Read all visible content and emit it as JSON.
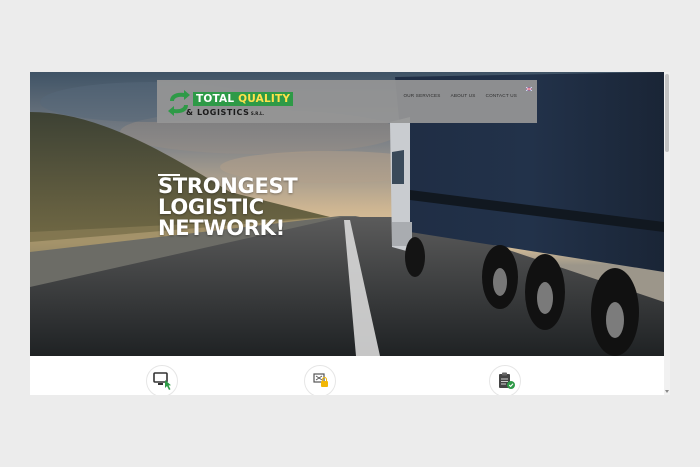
{
  "navbar": {
    "logo": {
      "line1_a": "TOTAL ",
      "line1_b": "QUALITY",
      "line2": "& LOGISTICS",
      "line2_suffix": " S.R.L."
    },
    "menu": [
      "OUR SERVICES",
      "ABOUT US",
      "CONTACT US"
    ],
    "language_icon": "uk-flag-icon"
  },
  "hero": {
    "headline": [
      "STRONGEST",
      "LOGISTIC",
      "NETWORK!"
    ]
  },
  "services": [
    {
      "icon": "monitor-click-icon"
    },
    {
      "icon": "screen-lock-icon"
    },
    {
      "icon": "clipboard-check-icon"
    }
  ],
  "colors": {
    "brand_green": "#2e9a47",
    "brand_yellow": "#ffe14b",
    "navbar_bg": "#969696"
  }
}
